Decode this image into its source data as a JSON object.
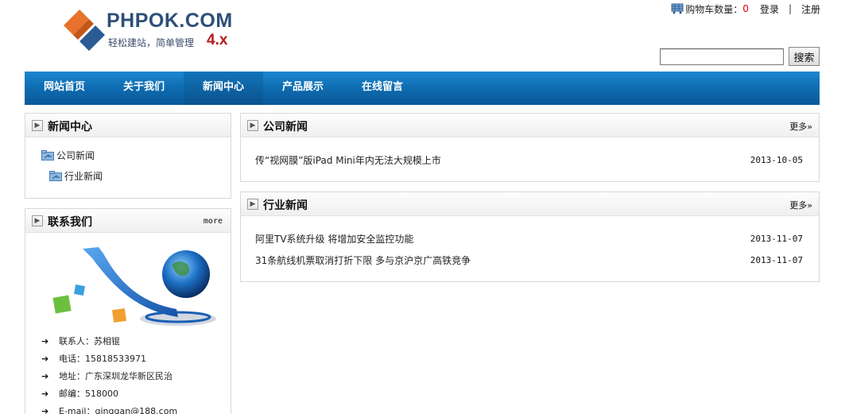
{
  "header": {
    "logo_title": "PHPOK.COM",
    "logo_slogan": "轻松建站，简单管理",
    "logo_version": "4.x",
    "cart_label": "购物车数量：",
    "cart_count": "0",
    "login": "登录",
    "separator": "|",
    "register": "注册",
    "search_placeholder": "",
    "search_button": "搜索"
  },
  "nav": {
    "items": [
      {
        "label": "网站首页"
      },
      {
        "label": "关于我们"
      },
      {
        "label": "新闻中心",
        "active": true
      },
      {
        "label": "产品展示"
      },
      {
        "label": "在线留言"
      }
    ]
  },
  "sidebar": {
    "news_center": {
      "title": "新闻中心",
      "categories": [
        {
          "label": "公司新闻"
        },
        {
          "label": "行业新闻"
        }
      ]
    },
    "contact": {
      "title": "联系我们",
      "more": "more",
      "lines": [
        {
          "label": "联系人：苏相锟"
        },
        {
          "label": "电话：15818533971"
        },
        {
          "label": "地址：广东深圳龙华新区民治"
        },
        {
          "label": "邮编：518000"
        },
        {
          "label": "E-mail：qinggan@188.com"
        }
      ]
    }
  },
  "main": {
    "company_news": {
      "title": "公司新闻",
      "more": "更多»",
      "items": [
        {
          "title": "传“视网膜”版iPad Mini年内无法大规模上市",
          "date": "2013-10-05"
        }
      ]
    },
    "industry_news": {
      "title": "行业新闻",
      "more": "更多»",
      "items": [
        {
          "title": "阿里TV系统升级 将增加安全监控功能",
          "date": "2013-11-07"
        },
        {
          "title": "31条航线机票取消打折下限 多与京沪京广高铁竞争",
          "date": "2013-11-07"
        }
      ]
    }
  },
  "colors": {
    "nav_blue": "#0d69ad",
    "logo_blue": "#2d4f78",
    "logo_orange": "#e8722c",
    "version_red": "#b3191b",
    "cart_count_red": "#dd0000"
  }
}
